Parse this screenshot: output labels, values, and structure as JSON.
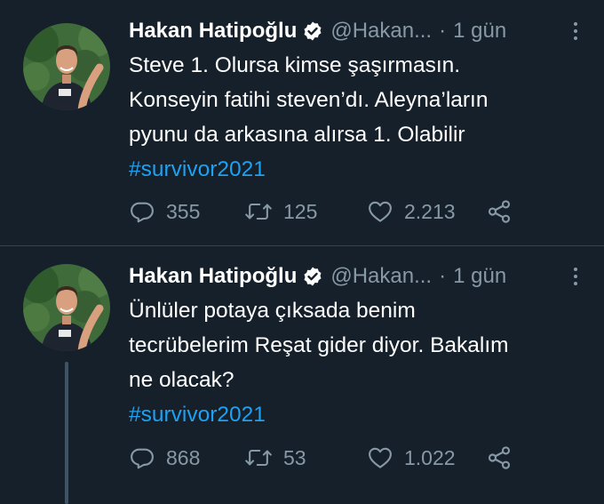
{
  "tweets": [
    {
      "author_name": "Hakan Hatipoğlu",
      "handle": "@Hakan...",
      "separator": "·",
      "time": "1 gün",
      "text_lines": [
        "Steve 1. Olursa kimse şaşırmasın.",
        "Konseyin fatihi steven’dı. Aleyna’ların",
        "pyunu da arkasına alırsa 1. Olabilir"
      ],
      "hashtag": "#survivor2021",
      "replies": "355",
      "retweets": "125",
      "likes": "2.213"
    },
    {
      "author_name": "Hakan Hatipoğlu",
      "handle": "@Hakan...",
      "separator": "·",
      "time": "1 gün",
      "text_lines": [
        "Ünlüler potaya çıksada benim",
        "tecrübelerim Reşat gider diyor. Bakalım",
        "ne olacak?"
      ],
      "hashtag": "#survivor2021",
      "replies": "868",
      "retweets": "53",
      "likes": "1.022"
    }
  ],
  "icons": {
    "verified": "verified-badge-icon",
    "more": "more-vertical-icon",
    "reply": "reply-icon",
    "retweet": "retweet-icon",
    "like": "heart-icon",
    "share": "share-icon"
  },
  "colors": {
    "background": "#15202b",
    "text": "#ffffff",
    "secondary": "#8899a6",
    "hashtag": "#1da1f2",
    "divider": "#38444d"
  }
}
